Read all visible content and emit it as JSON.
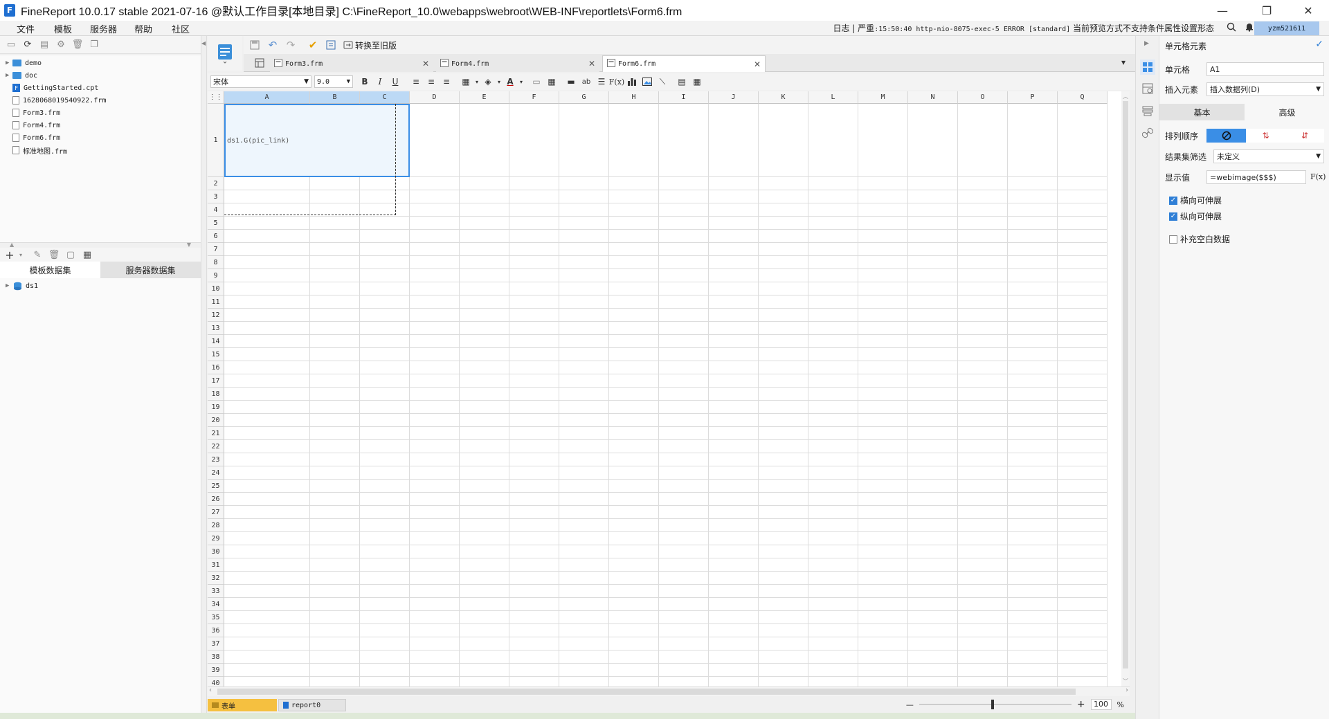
{
  "window": {
    "title": "FineReport 10.0.17 stable 2021-07-16 @默认工作目录[本地目录]    C:\\FineReport_10.0\\webapps\\webroot\\WEB-INF\\reportlets\\Form6.frm",
    "logo": "F",
    "minimize": "—",
    "maximize": "❐",
    "close": "✕"
  },
  "menu": {
    "items": [
      "文件",
      "模板",
      "服务器",
      "帮助",
      "社区"
    ],
    "log_label": "日志",
    "log_sep": "|",
    "log_level": "严重",
    "log_message": ":15:50:40 http-nio-8075-exec-5 ERROR [standard]",
    "log_text": "当前预览方式不支持条件属性设置形态",
    "user": "yzm521611"
  },
  "filetree": {
    "items": [
      {
        "label": "demo",
        "type": "folder",
        "expandable": true
      },
      {
        "label": "doc",
        "type": "folder",
        "expandable": true
      },
      {
        "label": "GettingStarted.cpt",
        "type": "cpt",
        "expandable": false
      },
      {
        "label": "1628068019540922.frm",
        "type": "doc",
        "expandable": false
      },
      {
        "label": "Form3.frm",
        "type": "doc",
        "expandable": false
      },
      {
        "label": "Form4.frm",
        "type": "doc",
        "expandable": false
      },
      {
        "label": "Form6.frm",
        "type": "doc",
        "expandable": false
      },
      {
        "label": "标准地图.frm",
        "type": "doc",
        "expandable": false
      }
    ]
  },
  "datasets": {
    "tab_template": "模板数据集",
    "tab_server": "服务器数据集",
    "items": [
      {
        "label": "ds1"
      }
    ]
  },
  "toolbar": {
    "convert_label": "转换至旧版"
  },
  "tabs": [
    {
      "label": "Form3.frm",
      "active": false
    },
    {
      "label": "Form4.frm",
      "active": false
    },
    {
      "label": "Form6.frm",
      "active": true
    }
  ],
  "format": {
    "font": "宋体",
    "size": "9.0",
    "bold": "B",
    "italic": "I",
    "underline": "U"
  },
  "grid": {
    "columns": [
      "A",
      "B",
      "C",
      "D",
      "E",
      "F",
      "G",
      "H",
      "I",
      "J",
      "K",
      "L",
      "M",
      "N",
      "O",
      "P",
      "Q"
    ],
    "rows": [
      "1",
      "2",
      "3",
      "4",
      "5",
      "6",
      "7",
      "8",
      "9",
      "10",
      "11",
      "12",
      "13",
      "14",
      "15",
      "16",
      "17",
      "18",
      "19",
      "20",
      "21",
      "22",
      "23",
      "24",
      "25",
      "26",
      "27",
      "28",
      "29",
      "30",
      "31",
      "32",
      "33",
      "34",
      "35",
      "36",
      "37",
      "38",
      "39",
      "40"
    ],
    "cell_a1": "ds1.G(pic_link)"
  },
  "sheets": {
    "form": "表单",
    "report": "report0"
  },
  "zoom": {
    "minus": "—",
    "plus": "+",
    "value": "100",
    "unit": "%"
  },
  "rightpanel": {
    "title": "单元格元素",
    "cell_label": "单元格",
    "cell_value": "A1",
    "insert_label": "插入元素",
    "insert_value": "插入数据列(D)",
    "tab_basic": "基本",
    "tab_advanced": "高级",
    "sort_label": "排列顺序",
    "filter_label": "结果集筛选",
    "filter_value": "未定义",
    "display_label": "显示值",
    "display_value": "=webimage($$$)",
    "fx": "F(x)",
    "cb_horizontal": "横向可伸展",
    "cb_vertical": "纵向可伸展",
    "cb_fill": "补充空白数据"
  }
}
